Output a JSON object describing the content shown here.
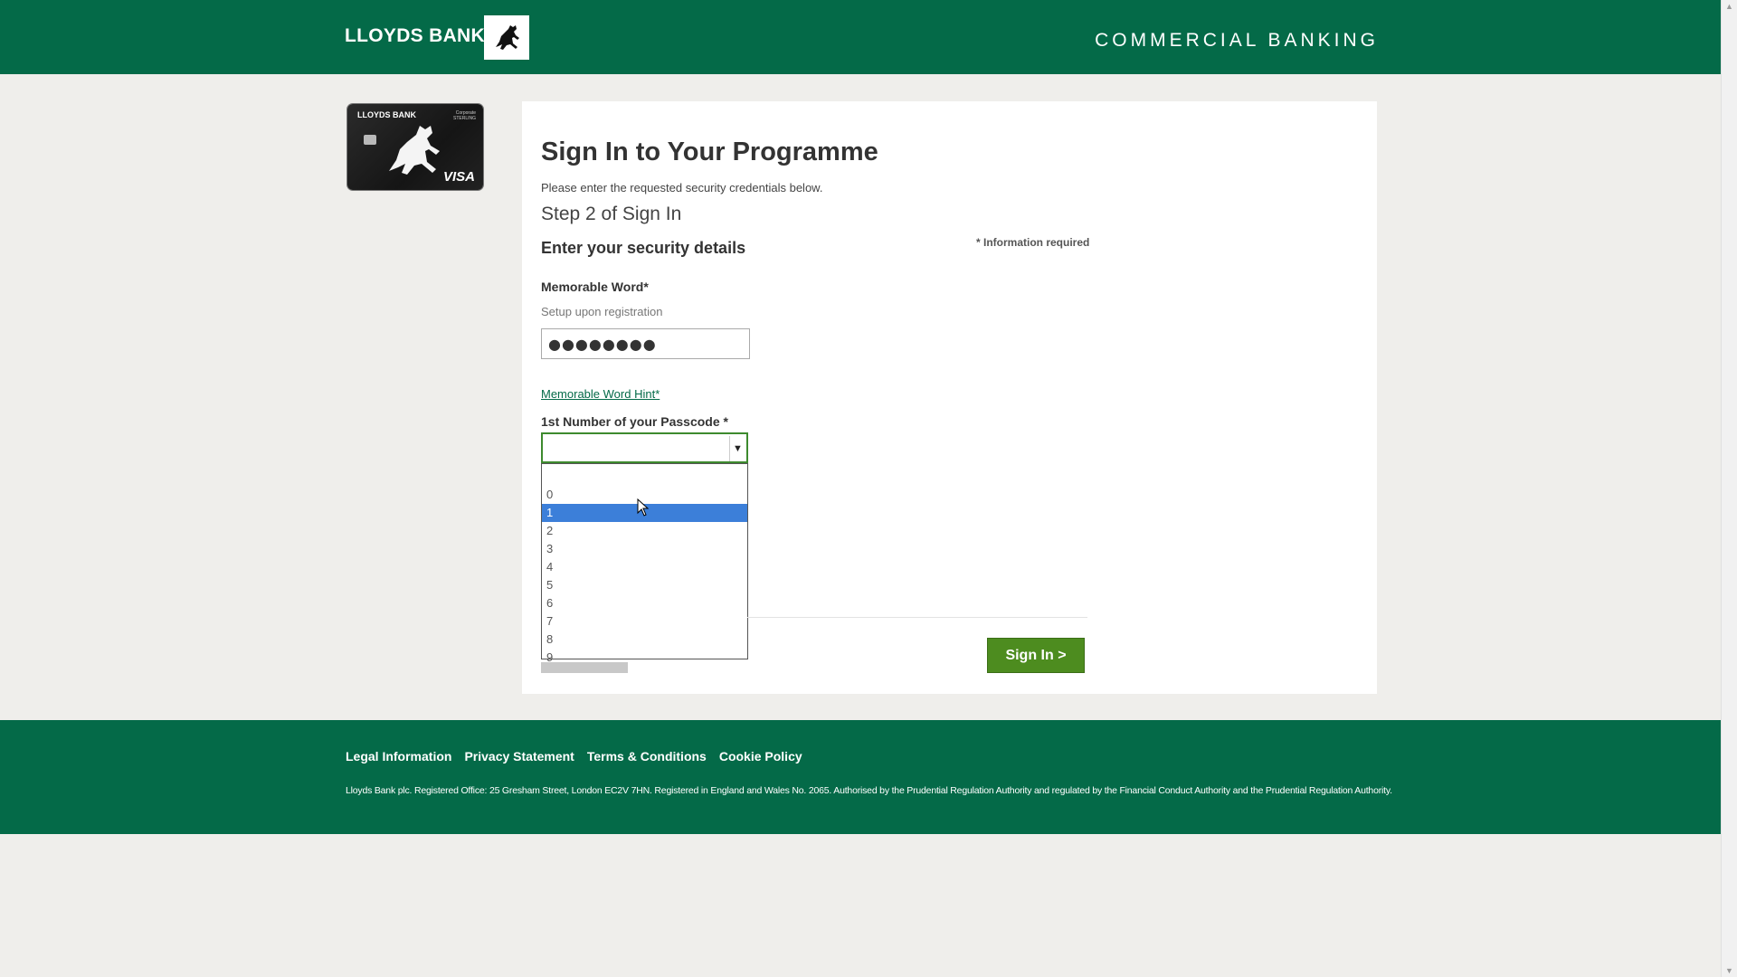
{
  "header": {
    "brand": "LLOYDS BANK",
    "section": "COMMERCIAL BANKING",
    "logo_icon": "horse-icon"
  },
  "card": {
    "brand": "LLOYDS BANK",
    "corporate": "Corporate STERLING",
    "network": "VISA"
  },
  "form": {
    "title": "Sign In to Your Programme",
    "subtitle": "Please enter the requested security credentials below.",
    "step": "Step 2 of Sign In",
    "section_heading": "Enter your security details",
    "required_note": "* Information required",
    "memorable_word": {
      "label": "Memorable Word*",
      "help": "Setup upon registration",
      "value": "●●●●●●●●"
    },
    "hint_link": "Memorable Word Hint*",
    "passcode": {
      "label": "1st Number of your Passcode *",
      "selected": "",
      "options": [
        "",
        "0",
        "1",
        "2",
        "3",
        "4",
        "5",
        "6",
        "7",
        "8",
        "9"
      ],
      "highlighted": "1"
    },
    "signin_label": "Sign In >"
  },
  "footer": {
    "links": [
      "Legal Information",
      "Privacy Statement",
      "Terms & Conditions",
      "Cookie Policy"
    ],
    "legal": "Lloyds Bank plc. Registered Office: 25 Gresham Street, London EC2V 7HN. Registered in England and Wales No. 2065. Authorised by the Prudential Regulation Authority and regulated by the Financial Conduct Authority and the Prudential Regulation Authority."
  },
  "colors": {
    "brand_green": "#046a48",
    "button_green": "#4d8c1f",
    "highlight_blue": "#3c7fd9"
  }
}
